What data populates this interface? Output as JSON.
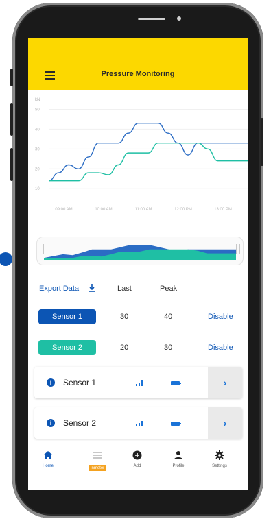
{
  "app": {
    "title": "Pressure Monitoring"
  },
  "colors": {
    "accent": "#fcd800",
    "primary": "#0c55b4",
    "series_1": "#2b6cc4",
    "series_2": "#1fbfa4",
    "badge": "#f4a220"
  },
  "chart_data": {
    "type": "line",
    "ylabel": "kN",
    "yticks": [
      "50",
      "40",
      "30",
      "20",
      "10"
    ],
    "ylim": [
      8,
      55
    ],
    "xticks": [
      "09:00 AM",
      "10:00 AM",
      "11:00 AM",
      "12:00 PM",
      "13:00 PM"
    ],
    "x": [
      0,
      1,
      2,
      3,
      4,
      5,
      6,
      7,
      8,
      9,
      10,
      11,
      12,
      13,
      14,
      15,
      16,
      17,
      18,
      19,
      20
    ],
    "series": [
      {
        "values": [
          14,
          18,
          22,
          20,
          26,
          33,
          33,
          33,
          38,
          43,
          43,
          43,
          38,
          33,
          27,
          33,
          33,
          33,
          33,
          33,
          33
        ]
      },
      {
        "values": [
          14,
          14,
          14,
          14,
          18,
          18,
          17,
          22,
          28,
          28,
          28,
          33,
          33,
          33,
          33,
          33,
          30,
          24,
          24,
          24,
          24
        ]
      }
    ],
    "grid": true
  },
  "navigator": {
    "ranges": [
      "area-series-1",
      "area-series-2"
    ]
  },
  "table": {
    "export_label": "Export Data",
    "export_icon": "download-icon",
    "col_last": "Last",
    "col_peak": "Peak",
    "rows": [
      {
        "name": "Sensor 1",
        "last": "30",
        "peak": "40",
        "action": "Disable",
        "color": "#0c55b4"
      },
      {
        "name": "Sensor 2",
        "last": "20",
        "peak": "30",
        "action": "Disable",
        "color": "#1fbfa4"
      }
    ]
  },
  "cards": [
    {
      "label": "Sensor 1",
      "icons": [
        "info-icon",
        "signal-icon",
        "battery-icon",
        "chevron-right-icon"
      ],
      "chevron": "›"
    },
    {
      "label": "Sensor 2",
      "icons": [
        "info-icon",
        "signal-icon",
        "battery-icon",
        "chevron-right-icon"
      ],
      "chevron": "›"
    }
  ],
  "bottom_nav": [
    {
      "label": "Home",
      "icon": "home-icon",
      "active": true
    },
    {
      "label": "Inmeter",
      "icon": "list-icon",
      "badge": true
    },
    {
      "label": "Add",
      "icon": "add-circle-icon"
    },
    {
      "label": "Profile",
      "icon": "person-icon"
    },
    {
      "label": "Settings",
      "icon": "gear-icon"
    }
  ]
}
